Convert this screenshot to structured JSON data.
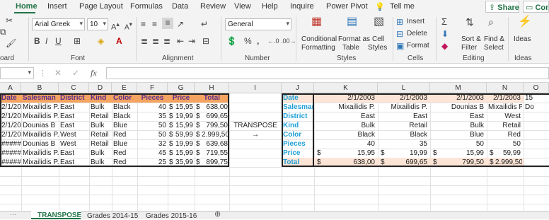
{
  "tabs": [
    "Home",
    "Insert",
    "Page Layout",
    "Formulas",
    "Data",
    "Review",
    "View",
    "Help",
    "Inquire",
    "Power Pivot",
    "Tell me"
  ],
  "tell_me_icon": "lightbulb-icon",
  "share_label": "Share",
  "comments_label": "Com",
  "ribbon": {
    "clipboard_label": "oard",
    "font_label": "Font",
    "font_name": "Arial Greek",
    "font_size": "10",
    "alignment_label": "Alignment",
    "number_label": "Number",
    "number_format": "General",
    "styles_label": "Styles",
    "conditional_formatting": "Conditional",
    "conditional_formatting2": "Formatting",
    "format_as_table": "Format as",
    "format_as_table2": "Table",
    "cell_styles": "Cell",
    "cell_styles2": "Styles",
    "cells_label": "Cells",
    "insert": "Insert",
    "delete": "Delete",
    "format": "Format",
    "editing_label": "Editing",
    "sort_filter": "Sort &",
    "sort_filter2": "Filter",
    "find_select": "Find &",
    "find_select2": "Select",
    "ideas": "Ideas",
    "ideas_label": "Ideas"
  },
  "formula_bar": {
    "fx": "fx"
  },
  "columns": [
    "A",
    "B",
    "C",
    "D",
    "E",
    "F",
    "G",
    "H",
    "I",
    "J",
    "K",
    "L",
    "M",
    "N",
    "O"
  ],
  "left_table": {
    "headers": [
      "Date",
      "Salesman",
      "District",
      "Kind",
      "Color",
      "Pieces",
      "Price",
      "Total"
    ],
    "rows": [
      [
        "2/1/2003",
        "Mixailidis P.",
        "East",
        "Bulk",
        "Black",
        "40",
        "$",
        "15,95",
        "$",
        "638,00"
      ],
      [
        "2/1/2003",
        "Mixailidis P.",
        "East",
        "Retail",
        "Black",
        "35",
        "$",
        "19,99",
        "$",
        "699,65"
      ],
      [
        "2/1/2003",
        "Dounias B",
        "East",
        "Bulk",
        "Blue",
        "50",
        "$",
        "15,99",
        "$",
        "799,50"
      ],
      [
        "2/1/2003",
        "Mixailidis P.",
        "West",
        "Retail",
        "Red",
        "50",
        "$",
        "59,99",
        "$",
        "2.999,50"
      ],
      [
        "########",
        "Dounias B",
        "West",
        "Retail",
        "Blue",
        "32",
        "$",
        "19,99",
        "$",
        "639,68"
      ],
      [
        "########",
        "Mixailidis P.",
        "East",
        "Bulk",
        "Red",
        "45",
        "$",
        "15,99",
        "$",
        "719,55"
      ],
      [
        "########",
        "Mixailidis P.",
        "East",
        "Bulk",
        "Red",
        "25",
        "$",
        "35,99",
        "$",
        "899,75"
      ]
    ]
  },
  "transpose_label": "TRANSPOSE",
  "transpose_arrow": "→",
  "right_table": {
    "row_labels": [
      "Date",
      "Salesman",
      "District",
      "Kind",
      "Color",
      "Pieces",
      "Price",
      "Total"
    ],
    "cols": [
      [
        "2/1/2003",
        "Mixailidis P.",
        "East",
        "Bulk",
        "Black",
        "40",
        "15,95",
        "638,00"
      ],
      [
        "2/1/2003",
        "Mixailidis P.",
        "East",
        "Retail",
        "Black",
        "35",
        "19,99",
        "699,65"
      ],
      [
        "2/1/2003",
        "Dounias B",
        "East",
        "Bulk",
        "Blue",
        "50",
        "15,99",
        "799,50"
      ],
      [
        "2/1/2003",
        "Mixailidis P.",
        "West",
        "Retail",
        "Red",
        "50",
        "59,99",
        "2.999,50"
      ],
      [
        "15",
        "Do",
        "",
        "",
        "",
        "",
        "",
        ""
      ]
    ],
    "dollar": "$"
  },
  "sheets": [
    "TRANSPOSE",
    "Grades 2014-15",
    "Grades 2015-16"
  ],
  "colors": {
    "excel_green": "#217346",
    "header_orange": "#f4a460",
    "header_purple_text": "#5b2d8e",
    "right_label_blue": "#1fa0d8",
    "right_total_bg": "#fce4d6"
  }
}
